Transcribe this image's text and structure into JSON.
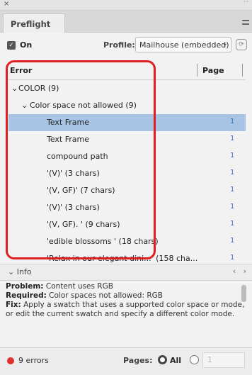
{
  "window": {
    "close": "×",
    "more": "··"
  },
  "panel": {
    "tab_label": "Preflight"
  },
  "controls": {
    "on_label": "On",
    "profile_label": "Profile:",
    "profile_value": "Mailhouse (embedded)"
  },
  "table": {
    "col_error": "Error",
    "col_page": "Page",
    "rows": [
      {
        "label": "COLOR (9)",
        "page": ""
      },
      {
        "label": "Color space not allowed (9)",
        "page": ""
      },
      {
        "label": "Text Frame",
        "page": "1"
      },
      {
        "label": "Text Frame",
        "page": "1"
      },
      {
        "label": "compound path",
        "page": "1"
      },
      {
        "label": "'(V)' (3 chars)",
        "page": "1"
      },
      {
        "label": "'(V, GF)' (7 chars)",
        "page": "1"
      },
      {
        "label": "'(V)' (3 chars)",
        "page": "1"
      },
      {
        "label": "'(V, GF). ' (9 chars)",
        "page": "1"
      },
      {
        "label": "'edible blossoms ' (18 chars)",
        "page": "1"
      },
      {
        "label": "'Relax in our elegant dini...' (158 cha...",
        "page": "1"
      }
    ]
  },
  "info": {
    "title": "Info",
    "problem_label": "Problem:",
    "problem": "Content uses RGB",
    "required_label": "Required:",
    "required": "Color spaces not allowed: RGB",
    "fix_label": "Fix:",
    "fix": "Apply a swatch that uses a supported color space or mode, or edit the current swatch and specify a different color mode."
  },
  "status": {
    "errors": "9 errors",
    "pages_label": "Pages:",
    "all_label": "All",
    "range_value": "1"
  },
  "colors": {
    "selected_row": "#a8c4e4",
    "highlight": "#e02020",
    "error_dot": "#e03030",
    "page_link": "#3a6ec0"
  }
}
